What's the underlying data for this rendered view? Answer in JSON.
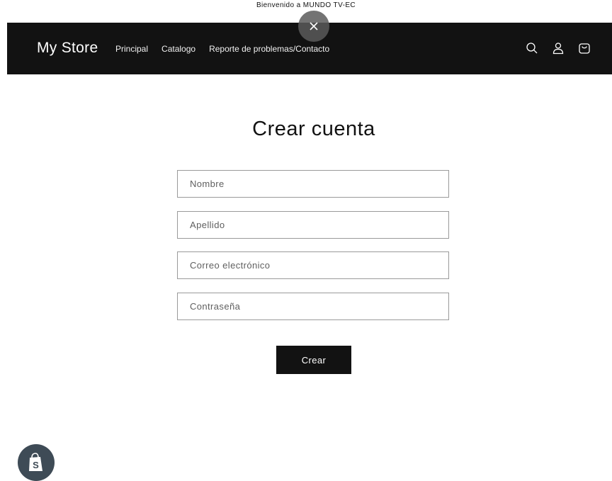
{
  "announcement": {
    "text": "Bienvenido a MUNDO TV-EC"
  },
  "header": {
    "logo": "My Store",
    "nav": [
      "Principal",
      "Catalogo",
      "Reporte de problemas/Contacto"
    ],
    "icons": [
      "search-icon",
      "account-icon",
      "cart-icon"
    ]
  },
  "overlay": {
    "icon": "close-icon"
  },
  "form": {
    "title": "Crear cuenta",
    "fields": [
      {
        "placeholder": "Nombre",
        "value": ""
      },
      {
        "placeholder": "Apellido",
        "value": ""
      },
      {
        "placeholder": "Correo electrónico",
        "value": ""
      },
      {
        "placeholder": "Contraseña",
        "value": ""
      }
    ],
    "submit_label": "Crear"
  },
  "badge": {
    "icon": "shopify-icon"
  },
  "colors": {
    "header_bg": "#121212",
    "button_bg": "#121212",
    "badge_bg": "#3e4b56"
  }
}
